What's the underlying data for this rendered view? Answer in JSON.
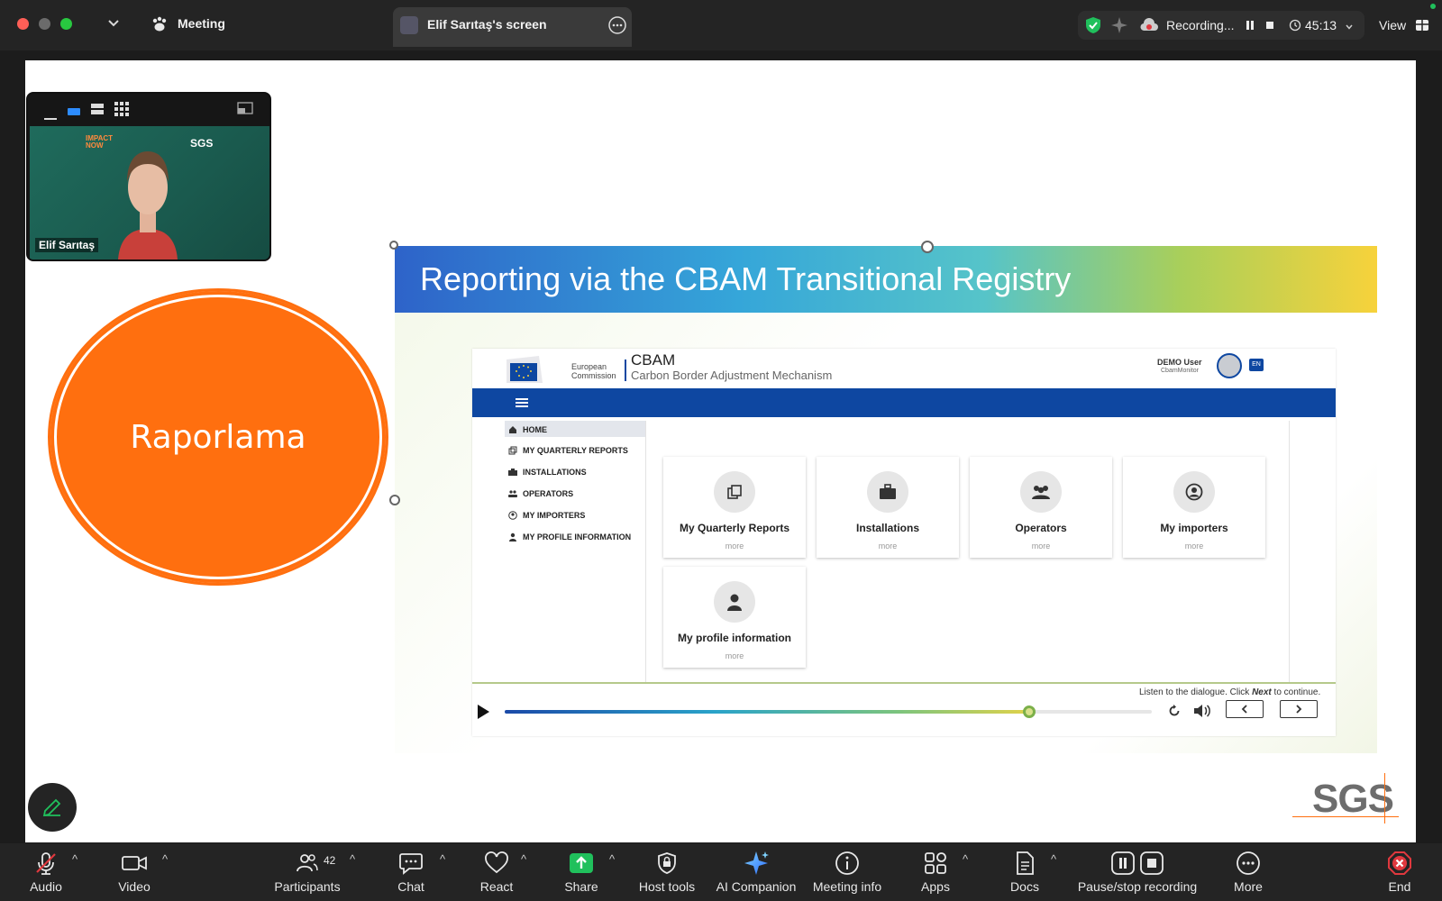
{
  "titlebar": {
    "meeting_label": "Meeting",
    "screen_tab_label": "Elif Sarıtaş's screen",
    "recording_label": "Recording...",
    "timer": "45:13",
    "view_label": "View"
  },
  "video_tile": {
    "participant_name": "Elif Sarıtaş",
    "backdrop_logo_left": "IMPACT NOW",
    "backdrop_logo_right": "SGS"
  },
  "share": {
    "circle_label": "Raporlama",
    "brand_logo": "SGS"
  },
  "slide": {
    "title": "Reporting via the CBAM Transitional Registry",
    "cbam_app": {
      "ec_label_line1": "European",
      "ec_label_line2": "Commission",
      "app_title": "CBAM",
      "app_subtitle": "Carbon Border Adjustment Mechanism",
      "user_name": "DEMO User",
      "user_role": "CbamMonitor",
      "lang": "EN",
      "sidebar": [
        {
          "label": "HOME",
          "icon": "home-icon"
        },
        {
          "label": "MY QUARTERLY REPORTS",
          "icon": "reports-icon"
        },
        {
          "label": "INSTALLATIONS",
          "icon": "briefcase-icon"
        },
        {
          "label": "OPERATORS",
          "icon": "group-icon"
        },
        {
          "label": "MY IMPORTERS",
          "icon": "user-circle-icon"
        },
        {
          "label": "MY PROFILE INFORMATION",
          "icon": "user-icon"
        }
      ],
      "cards": [
        {
          "title": "My Quarterly Reports",
          "more": "more",
          "icon": "reports-icon"
        },
        {
          "title": "Installations",
          "more": "more",
          "icon": "briefcase-icon"
        },
        {
          "title": "Operators",
          "more": "more",
          "icon": "group-icon"
        },
        {
          "title": "My importers",
          "more": "more",
          "icon": "user-circle-icon"
        },
        {
          "title": "My profile information",
          "more": "more",
          "icon": "user-icon"
        }
      ]
    },
    "player": {
      "instruction_prefix": "Listen to the dialogue. Click ",
      "instruction_emph": "Next",
      "instruction_suffix": " to continue.",
      "progress": 0.81
    }
  },
  "toolbar": {
    "audio": "Audio",
    "video": "Video",
    "participants": "Participants",
    "participants_count": "42",
    "chat": "Chat",
    "react": "React",
    "share": "Share",
    "host_tools": "Host tools",
    "ai_companion": "AI Companion",
    "meeting_info": "Meeting info",
    "apps": "Apps",
    "docs": "Docs",
    "pause_stop": "Pause/stop recording",
    "more": "More",
    "end": "End"
  },
  "colors": {
    "accent_orange": "#ff6f0f",
    "share_green": "#20c05c",
    "cbam_blue": "#0e47a1",
    "end_red": "#e0383e"
  }
}
